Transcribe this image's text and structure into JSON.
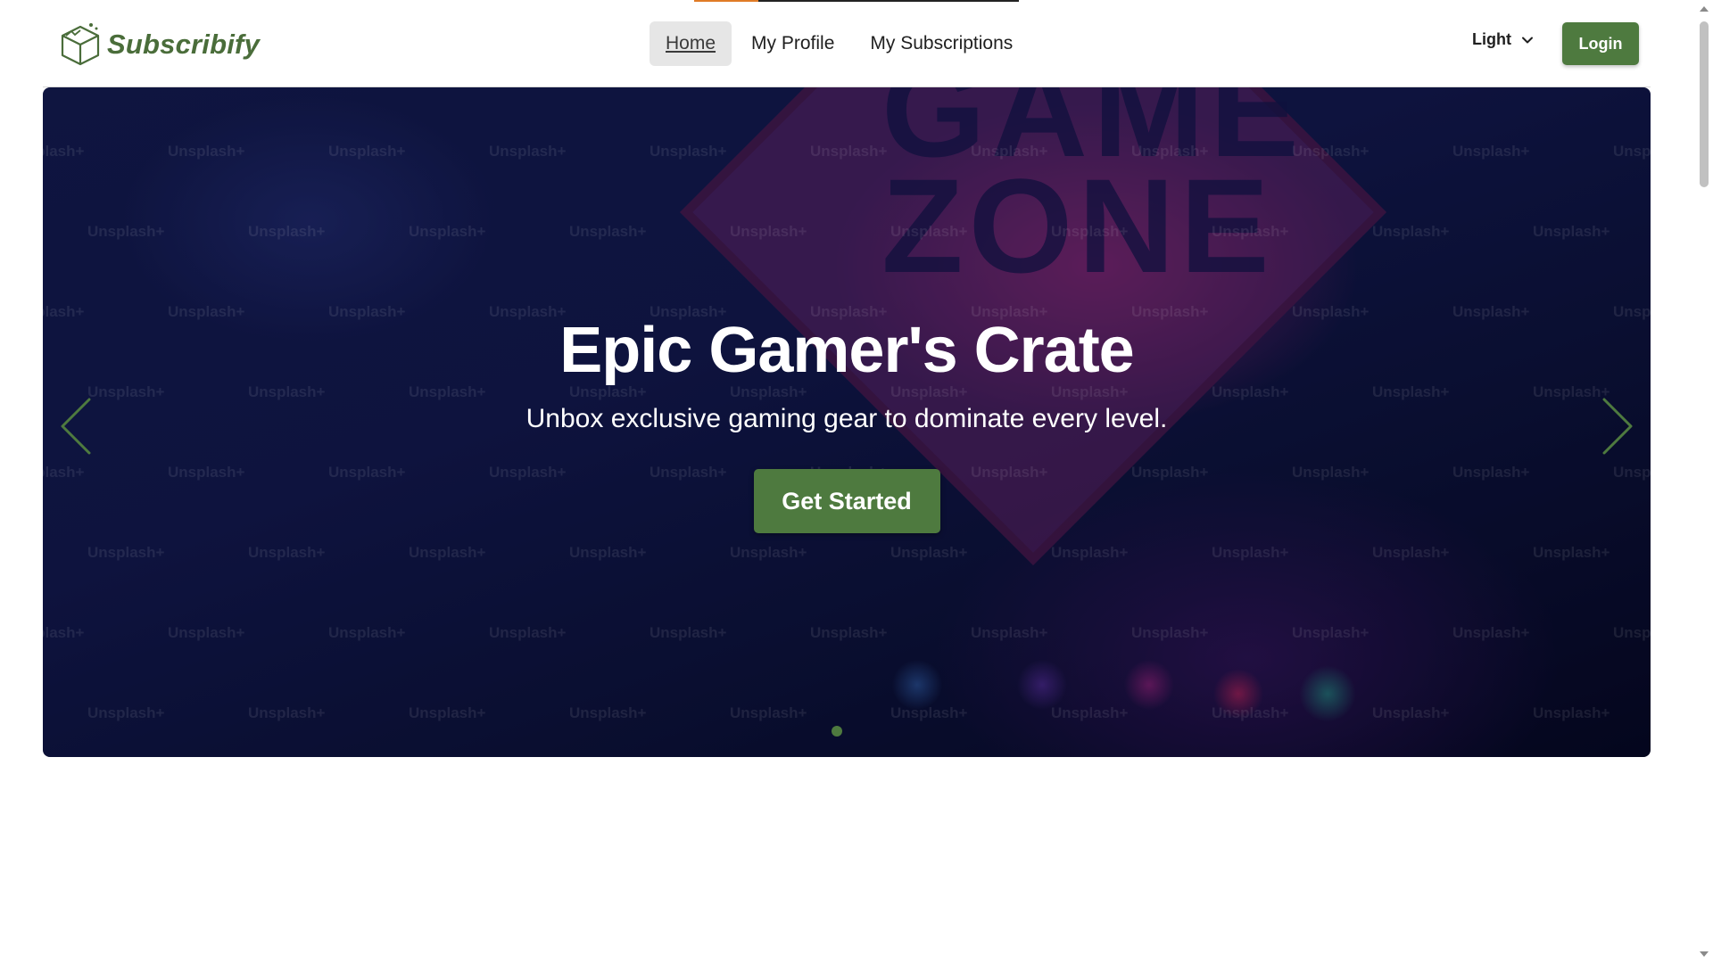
{
  "brand": {
    "name": "Subscribify",
    "color": "#4a6d3a",
    "logo_icon": "crate-box-icon"
  },
  "nav": {
    "links": [
      {
        "label": "Home",
        "active": true
      },
      {
        "label": "My Profile",
        "active": false
      },
      {
        "label": "My Subscriptions",
        "active": false
      }
    ]
  },
  "theme": {
    "selected": "Light",
    "icon": "chevron-down-icon"
  },
  "auth": {
    "login_label": "Login"
  },
  "hero": {
    "title": "Epic Gamer's Crate",
    "subtitle": "Unbox exclusive gaming gear to dominate every level.",
    "cta_label": "Get Started",
    "background_sign_text": "GAME ZONE",
    "watermark_text": "Unsplash+",
    "slide_count": 1,
    "active_slide": 1,
    "prev_icon": "chevron-left-icon",
    "next_icon": "chevron-right-icon"
  },
  "colors": {
    "accent": "#4e7a3f",
    "progress_orange": "#e07b26"
  }
}
